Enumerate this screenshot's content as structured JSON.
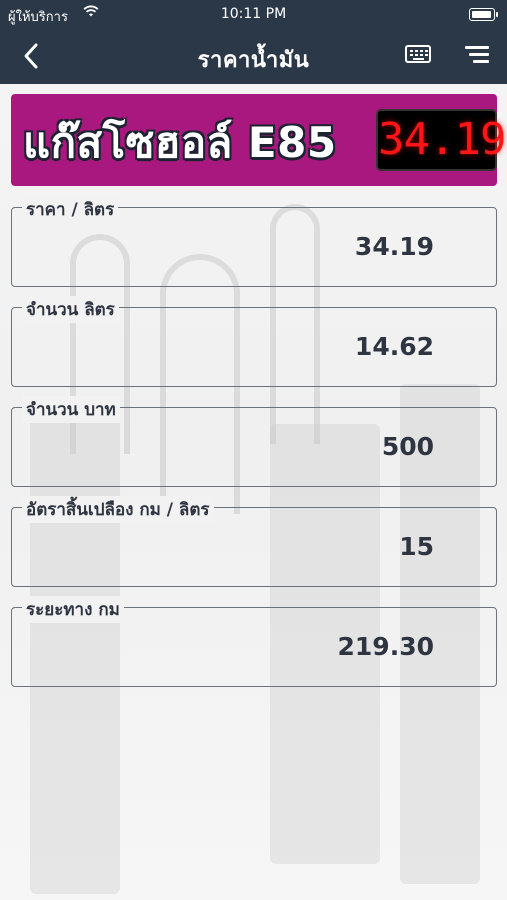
{
  "status_bar": {
    "carrier": "ผู้ให้บริการ",
    "wifi_icon": "wifi-icon",
    "time": "10:11 PM",
    "battery_icon": "battery-icon"
  },
  "nav": {
    "back_icon": "chevron-left-icon",
    "title": "ราคาน้ำมัน",
    "keyboard_icon": "keyboard-icon",
    "menu_icon": "menu-icon"
  },
  "banner": {
    "fuel_name": "แก๊สโซฮอล์ E85",
    "price_display": "34.19",
    "background_color": "#a8187e",
    "led_color": "#ff1515"
  },
  "fields": [
    {
      "label": "ราคา / ลิตร",
      "value": "34.19"
    },
    {
      "label": "จำนวน ลิตร",
      "value": "14.62"
    },
    {
      "label": "จำนวน บาท",
      "value": "500"
    },
    {
      "label": "อัตราสิ้นเปลือง กม / ลิตร",
      "value": "15"
    },
    {
      "label": "ระยะทาง กม",
      "value": "219.30"
    }
  ],
  "colors": {
    "header": "#2b3848",
    "text": "#2f3441"
  }
}
